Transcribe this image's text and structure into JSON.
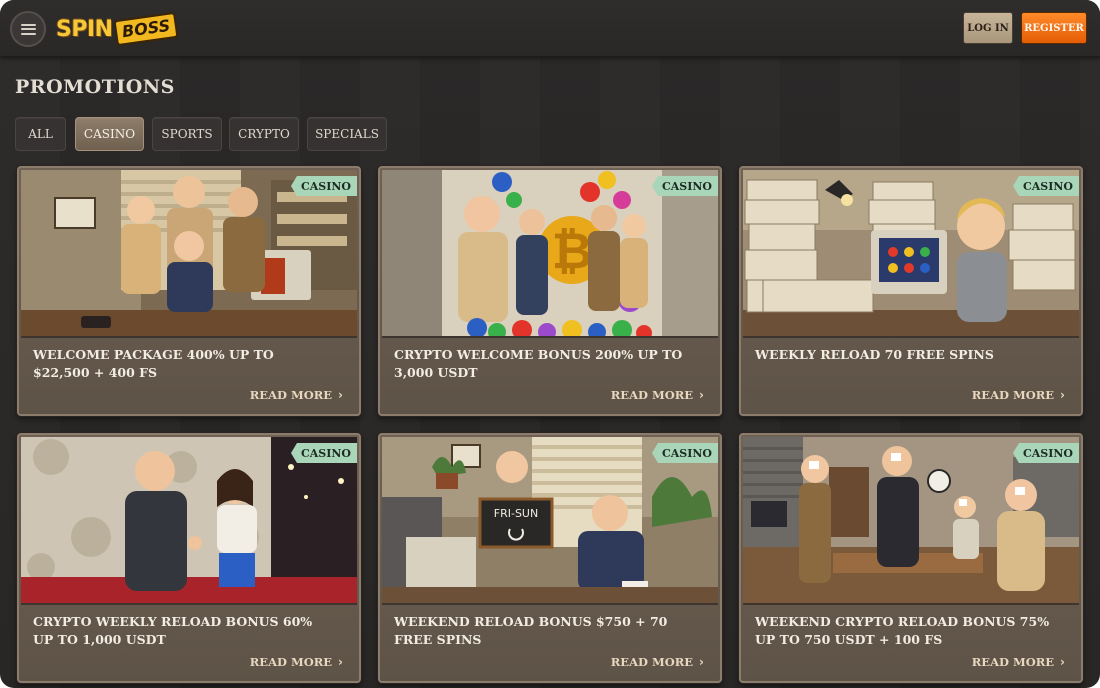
{
  "header": {
    "logo_primary": "SPIN",
    "logo_secondary": "BOSS",
    "login_label": "LOG IN",
    "register_label": "REGISTER",
    "menu_icon": "hamburger-icon"
  },
  "page": {
    "title": "PROMOTIONS"
  },
  "tabs": [
    {
      "label": "ALL",
      "active": false
    },
    {
      "label": "CASINO",
      "active": true
    },
    {
      "label": "SPORTS",
      "active": false
    },
    {
      "label": "CRYPTO",
      "active": false
    },
    {
      "label": "SPECIALS",
      "active": false
    }
  ],
  "promotions": [
    {
      "badge": "CASINO",
      "title": "WELCOME PACKAGE 400% UP TO $22,500 + 400 FS",
      "link": "READ MORE"
    },
    {
      "badge": "CASINO",
      "title": "CRYPTO WELCOME BONUS 200% UP TO 3,000 USDT",
      "link": "READ MORE"
    },
    {
      "badge": "CASINO",
      "title": "WEEKLY RELOAD 70 FREE SPINS",
      "link": "READ MORE"
    },
    {
      "badge": "CASINO",
      "title": "CRYPTO WEEKLY RELOAD BONUS 60% UP TO 1,000 USDT",
      "link": "READ MORE"
    },
    {
      "badge": "CASINO",
      "title": "WEEKEND RELOAD BONUS $750 + 70 FREE SPINS",
      "link": "READ MORE",
      "image_sign_text": "FRI-SUN"
    },
    {
      "badge": "CASINO",
      "title": "WEEKEND CRYPTO RELOAD BONUS 75% UP TO 750 USDT + 100 FS",
      "link": "READ MORE"
    }
  ],
  "colors": {
    "background": "#2a2827",
    "register": "#f07414",
    "login": "#bba88c",
    "badge": "#a9d6b8",
    "card": "#6a5d50",
    "tab_active": "#7e6e5d"
  }
}
